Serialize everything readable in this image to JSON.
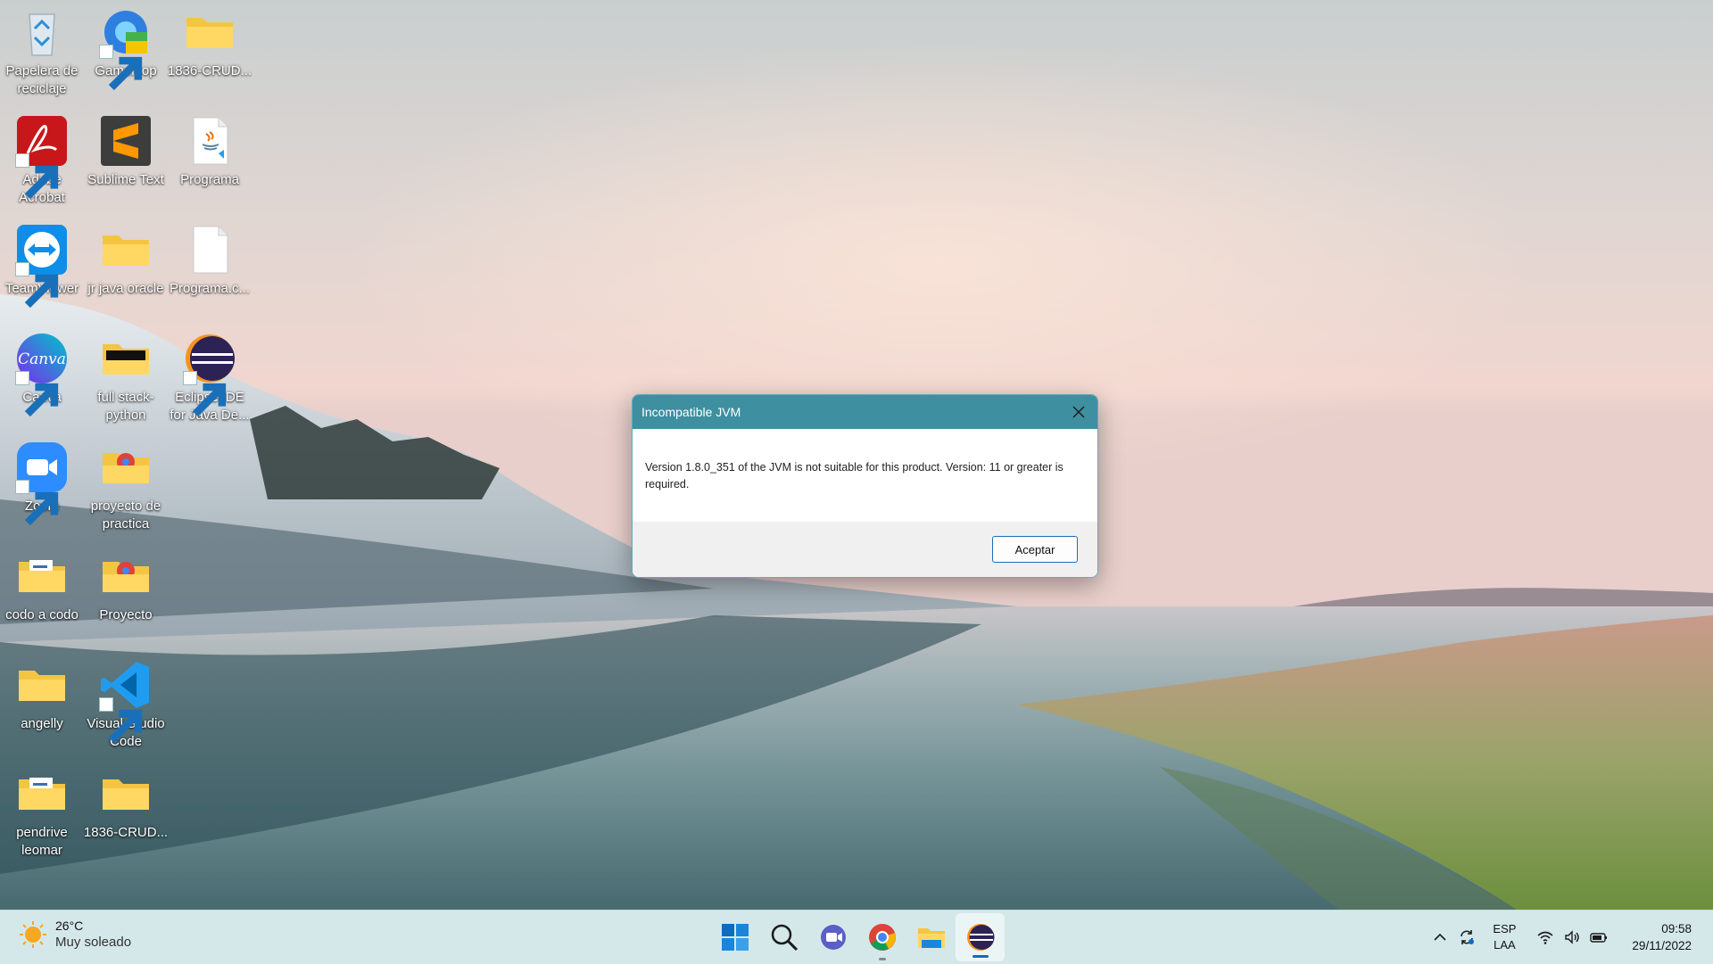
{
  "desktop": {
    "icons": [
      {
        "label": "Papelera de reciclaje",
        "icon": "recycle-bin-icon"
      },
      {
        "label": "Gameloop",
        "icon": "gameloop-icon"
      },
      {
        "label": "1836-CRUD...",
        "icon": "folder-icon"
      },
      {
        "label": "Adobe Acrobat",
        "icon": "adobe-acrobat-icon"
      },
      {
        "label": "Sublime Text",
        "icon": "sublime-text-icon"
      },
      {
        "label": "Programa",
        "icon": "java-file-icon"
      },
      {
        "label": "TeamViewer",
        "icon": "teamviewer-icon"
      },
      {
        "label": "jr java oracle",
        "icon": "folder-icon"
      },
      {
        "label": "Programa.c...",
        "icon": "file-icon"
      },
      {
        "label": "Canva",
        "icon": "canva-icon"
      },
      {
        "label": "full stack-python",
        "icon": "folder-icon"
      },
      {
        "label": "Eclipse IDE for Java De...",
        "icon": "eclipse-icon"
      },
      {
        "label": "Zoom",
        "icon": "zoom-icon"
      },
      {
        "label": "proyecto de practica",
        "icon": "folder-chrome-icon"
      },
      {
        "label": "codo a codo",
        "icon": "folder-icon"
      },
      {
        "label": "Proyecto",
        "icon": "folder-chrome-icon"
      },
      {
        "label": "angelly",
        "icon": "folder-icon"
      },
      {
        "label": "Visual Studio Code",
        "icon": "vscode-icon"
      },
      {
        "label": "pendrive leomar",
        "icon": "folder-icon"
      },
      {
        "label": "1836-CRUD...",
        "icon": "folder-icon"
      }
    ]
  },
  "dialog": {
    "title": "Incompatible JVM",
    "message": "Version 1.8.0_351 of the JVM is not suitable for this product. Version: 11 or greater is required.",
    "ok_label": "Aceptar",
    "close_icon": "close-icon"
  },
  "taskbar": {
    "weather": {
      "temperature": "26°C",
      "condition": "Muy soleado",
      "icon": "sun-icon"
    },
    "apps": [
      "windows-start-icon",
      "search-icon",
      "teams-chat-icon",
      "chrome-icon",
      "file-explorer-icon",
      "eclipse-icon"
    ],
    "tray": {
      "language": "ESP",
      "layout": "LAA",
      "time": "09:58",
      "date": "29/11/2022"
    }
  },
  "colors": {
    "dialog_title_bar": "#3e8fa0",
    "taskbar": "#d4e8ea",
    "button_border": "#1a6fb9"
  }
}
